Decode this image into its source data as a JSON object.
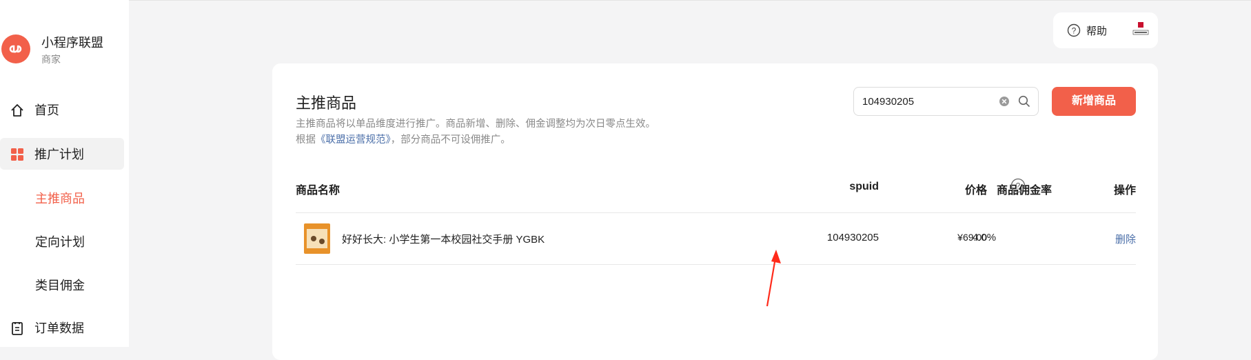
{
  "app": {
    "name": "小程序联盟",
    "role": "商家"
  },
  "sidebar": {
    "items": [
      {
        "label": "首页",
        "icon": "home-icon"
      },
      {
        "label": "推广计划",
        "icon": "grid-icon"
      },
      {
        "label": "主推商品",
        "active": true
      },
      {
        "label": "定向计划"
      },
      {
        "label": "类目佣金"
      },
      {
        "label": "订单数据",
        "icon": "clipboard-icon"
      }
    ]
  },
  "topbar": {
    "help_label": "帮助"
  },
  "main": {
    "title": "主推商品",
    "desc_line1": "主推商品将以单品维度进行推广。商品新增、删除、佣金调整均为次日零点生效。",
    "desc_line2_prefix": "根据",
    "desc_line2_link": "《联盟运营规范》",
    "desc_line2_suffix": "，部分商品不可设佣推广。",
    "search": {
      "value": "104930205",
      "placeholder": ""
    },
    "add_button": "新增商品",
    "table": {
      "columns": [
        "商品名称",
        "spuid",
        "价格",
        "商品佣金率",
        "操作"
      ],
      "rows": [
        {
          "name": "好好长大: 小学生第一本校园社交手册 YGBK",
          "spuid": "104930205",
          "price": "¥69.00",
          "commission": "4.0%",
          "action": "删除"
        }
      ]
    }
  },
  "colors": {
    "accent": "#f2604a",
    "link": "#4a6ea8",
    "annotation_arrow": "#ff2a1a"
  }
}
